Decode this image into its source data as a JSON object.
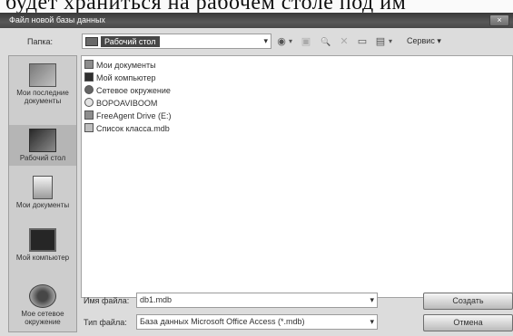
{
  "caption": {
    "text": "будет храниться на рабочем столе под им"
  },
  "dialog": {
    "title": "Файл новой базы данных",
    "close_glyph": "×"
  },
  "look_in": {
    "label": "Папка:",
    "value": "Рабочий стол",
    "arrow": "▾"
  },
  "toolbar": {
    "back": "◉",
    "back_arrow": "▾",
    "up": "▣",
    "search": "🔍",
    "delete": "✕",
    "new_folder": "▭",
    "views": "▤",
    "views_arrow": "▾",
    "service": "Сервис ▾"
  },
  "places_bar": [
    {
      "label": "Мои последние документы"
    },
    {
      "label": "Рабочий стол"
    },
    {
      "label": "Мои документы"
    },
    {
      "label": "Мой компьютер"
    },
    {
      "label": "Мое сетевое окружение"
    }
  ],
  "files": [
    {
      "name": "Мои документы"
    },
    {
      "name": "Мой компьютер"
    },
    {
      "name": "Сетевое окружение"
    },
    {
      "name": "BOPOAVIBOOM"
    },
    {
      "name": "FreeAgent Drive (E:)"
    },
    {
      "name": "Список класса.mdb"
    }
  ],
  "file_name": {
    "label": "Имя файла:",
    "value": "db1.mdb",
    "arrow": "▾"
  },
  "file_type": {
    "label": "Тип файла:",
    "value": "База данных Microsoft Office Access (*.mdb)",
    "arrow": "▾"
  },
  "buttons": {
    "create": "Создать",
    "cancel": "Отмена"
  }
}
